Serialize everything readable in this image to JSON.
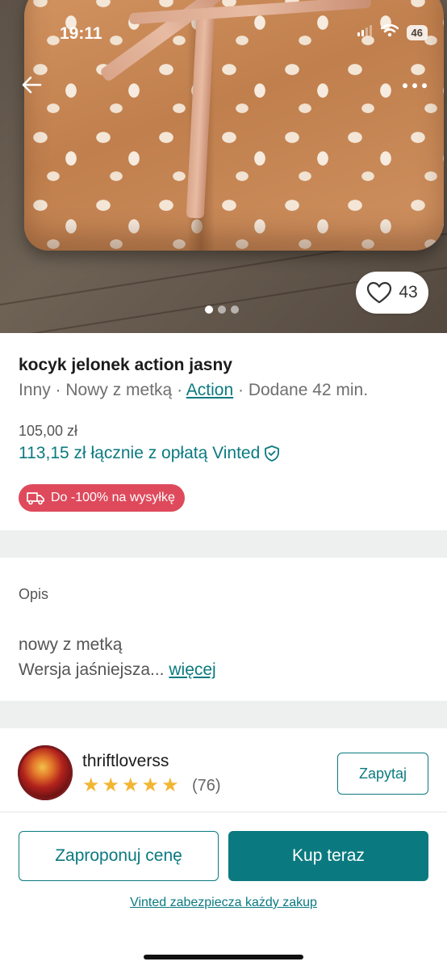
{
  "status_bar": {
    "time": "19:11",
    "battery": "46"
  },
  "gallery": {
    "likes": "43",
    "photo_count": 3,
    "active_index": 0
  },
  "item": {
    "title": "kocyk jelonek action jasny",
    "category": "Inny",
    "condition": "Nowy z metką",
    "brand": "Action",
    "added": "Dodane 42 min.",
    "separator": " · ",
    "price": "105,00 zł",
    "total": "113,15 zł łącznie z opłatą Vinted"
  },
  "promo": {
    "label": "Do -100% na wysyłkę"
  },
  "description": {
    "heading": "Opis",
    "line1": "nowy z metką",
    "line2": "Wersja jaśniejsza...",
    "more": "więcej"
  },
  "seller": {
    "username": "thriftloverss",
    "rating": 5,
    "reviews": "(76)",
    "ask_label": "Zapytaj"
  },
  "actions": {
    "offer_label": "Zaproponuj cenę",
    "buy_label": "Kup teraz",
    "protection_text": "Vinted zabezpiecza każdy zakup"
  },
  "colors": {
    "accent": "#0b7a80",
    "promo": "#de4a5c",
    "star": "#f2b632"
  },
  "icons": [
    "back-arrow-icon",
    "more-icon",
    "heart-icon",
    "shield-check-icon",
    "truck-icon",
    "star-icon",
    "signal-icon",
    "wifi-icon"
  ]
}
